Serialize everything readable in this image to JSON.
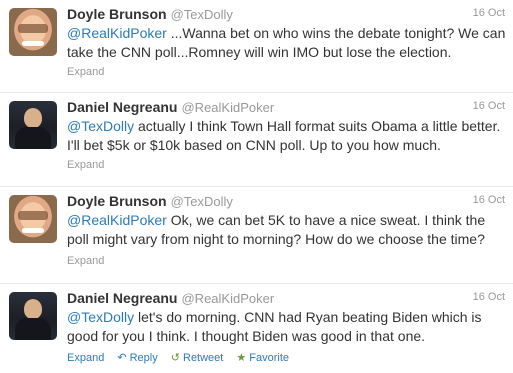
{
  "tweets": [
    {
      "name": "Doyle Brunson",
      "handle": "@TexDolly",
      "time": "16 Oct",
      "mention": "@RealKidPoker",
      "text": " ...Wanna bet on who wins the debate tonight? We can take the CNN poll...Romney will win IMO but lose the election.",
      "expand": "Expand"
    },
    {
      "name": "Daniel Negreanu",
      "handle": "@RealKidPoker",
      "time": "16 Oct",
      "mention": "@TexDolly",
      "text": " actually I think Town Hall format suits Obama a little better. I'll bet $5k or $10k based on CNN poll. Up to you how much.",
      "expand": "Expand"
    },
    {
      "name": "Doyle Brunson",
      "handle": "@TexDolly",
      "time": "16 Oct",
      "mention": "@RealKidPoker",
      "text": " Ok, we can bet 5K to have a nice sweat. I think the poll might vary from night to morning? How do we choose the time?",
      "expand": "Expand"
    },
    {
      "name": "Daniel Negreanu",
      "handle": "@RealKidPoker",
      "time": "16 Oct",
      "mention": "@TexDolly",
      "text": " let's do morning. CNN had Ryan beating Biden which is good for you I think. I thought Biden was good in that one.",
      "expand": "Expand",
      "reply": "Reply",
      "retweet": "Retweet",
      "favorite": "Favorite"
    }
  ],
  "icons": {
    "reply": "reply-arrow-icon",
    "retweet": "retweet-icon",
    "favorite": "star-icon"
  },
  "colors": {
    "link": "#2b7bb9",
    "muted": "#999999",
    "text": "#333333"
  }
}
